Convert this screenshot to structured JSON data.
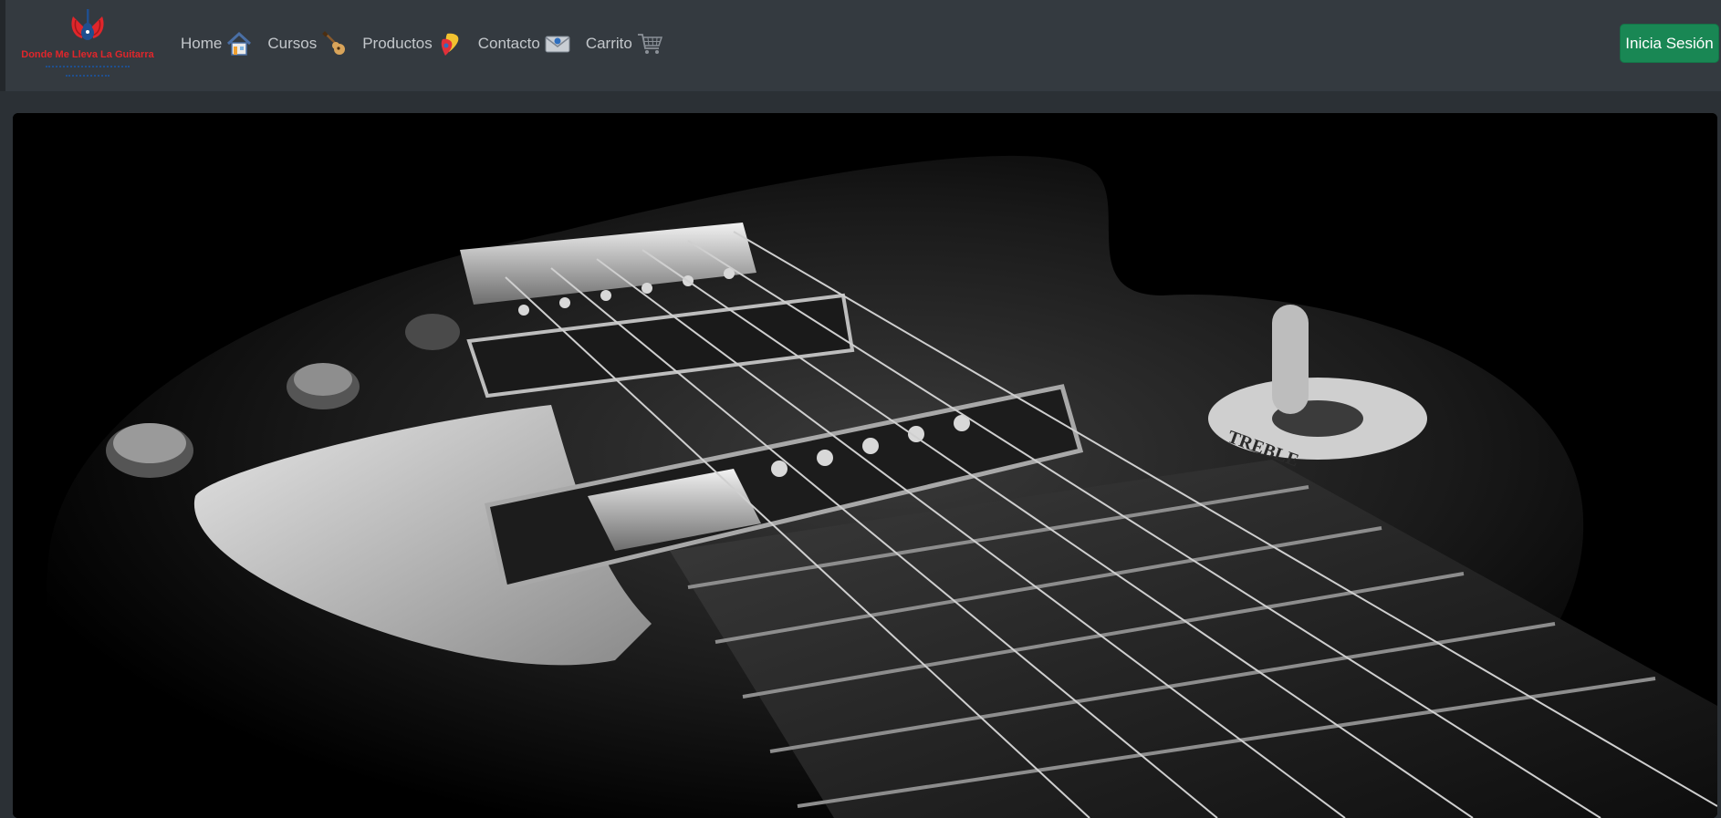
{
  "brand": {
    "title": "Donde Me Lleva La Guitarra"
  },
  "nav": [
    {
      "label": "Home",
      "icon": "house-icon"
    },
    {
      "label": "Cursos",
      "icon": "guitar-icon"
    },
    {
      "label": "Productos",
      "icon": "guitar-pick-icon"
    },
    {
      "label": "Contacto",
      "icon": "envelope-icon"
    },
    {
      "label": "Carrito",
      "icon": "cart-icon"
    }
  ],
  "login_button": {
    "label": "Inicia Sesión"
  },
  "hero": {
    "image": "guitar-closeup-photo",
    "toggle_label": "TREBLE"
  },
  "colors": {
    "navbar": "#343a40",
    "page": "#2b3035",
    "accent": "#198754",
    "brand_red": "#e0262b"
  }
}
